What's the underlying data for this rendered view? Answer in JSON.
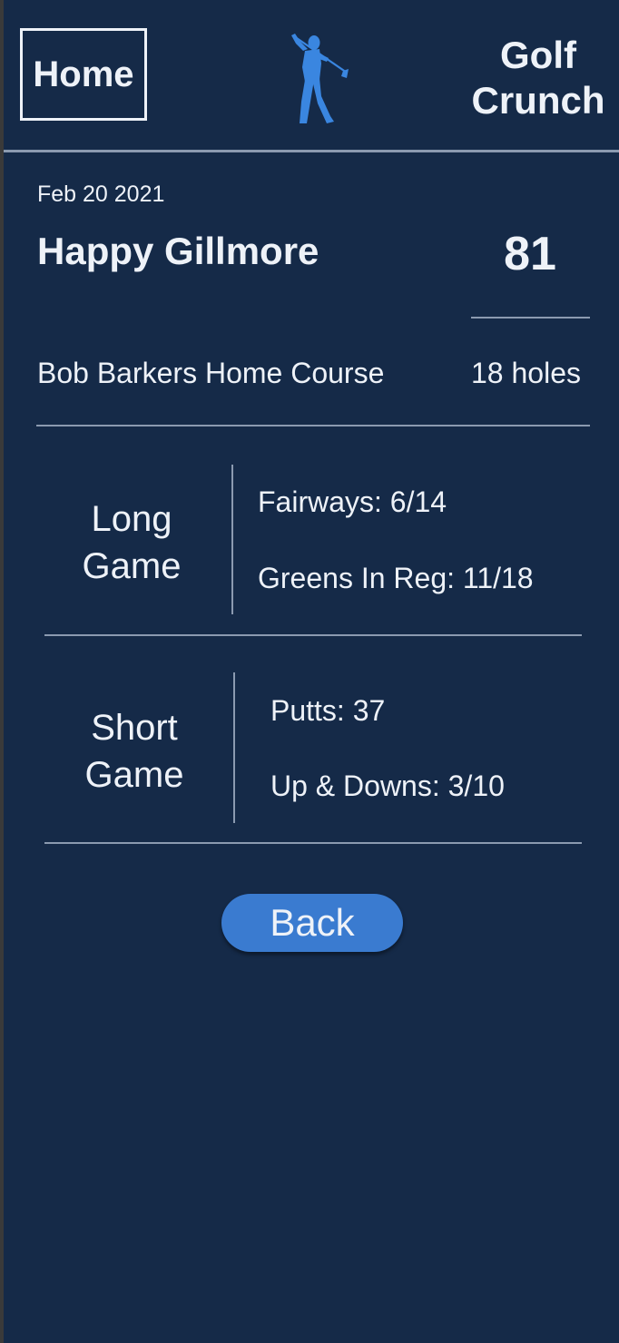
{
  "header": {
    "home_label": "Home",
    "brand_line1": "Golf",
    "brand_line2": "Crunch",
    "logo_color": "#3a86e0"
  },
  "round": {
    "date": "Feb 20 2021",
    "player": "Happy Gillmore",
    "score": "81",
    "course": "Bob Barkers Home Course",
    "holes": "18 holes"
  },
  "long_game": {
    "title_line1": "Long",
    "title_line2": "Game",
    "fairways": "Fairways: 6/14",
    "greens": "Greens In Reg: 11/18"
  },
  "short_game": {
    "title_line1": "Short",
    "title_line2": "Game",
    "putts": "Putts: 37",
    "up_downs": "Up & Downs: 3/10"
  },
  "actions": {
    "back_label": "Back"
  },
  "colors": {
    "background": "#152a48",
    "accent": "#3a7bd0",
    "divider": "#8b9ab0",
    "text": "#eef2f8"
  }
}
